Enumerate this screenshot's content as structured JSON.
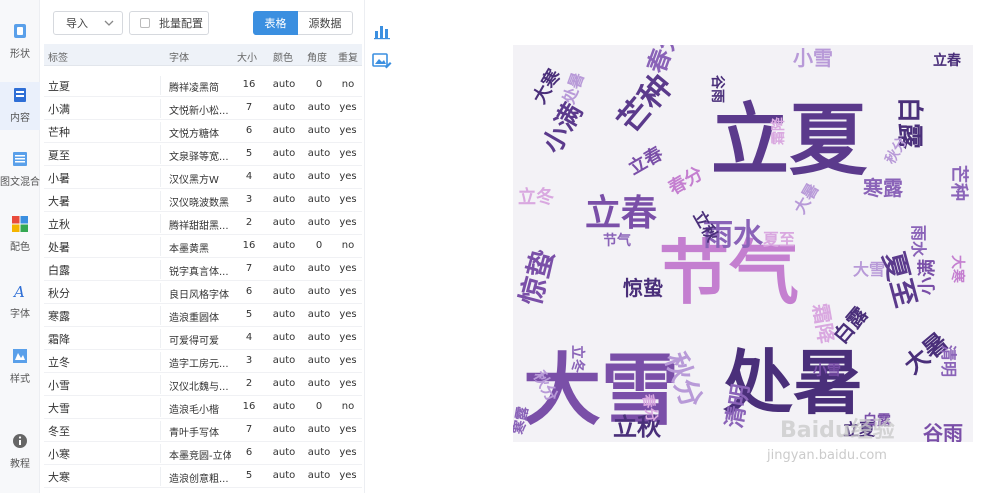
{
  "nav": [
    {
      "label": "形状",
      "icon": "shape-icon"
    },
    {
      "label": "内容",
      "icon": "content-icon"
    },
    {
      "label": "图文混合",
      "icon": "image-text-icon"
    },
    {
      "label": "配色",
      "icon": "palette-icon"
    },
    {
      "label": "字体",
      "icon": "font-icon"
    },
    {
      "label": "样式",
      "icon": "style-icon"
    },
    {
      "label": "教程",
      "icon": "info-icon"
    }
  ],
  "toolbar": {
    "import_label": "导入",
    "batch_label": "批量配置",
    "tab_table": "表格",
    "tab_source": "源数据"
  },
  "table": {
    "headers": [
      "标签",
      "字体",
      "大小",
      "颜色",
      "角度",
      "重复"
    ],
    "rows": [
      [
        "立夏",
        "腾祥凌黑简",
        "16",
        "auto",
        "0",
        "no"
      ],
      [
        "小满",
        "文悦新小松...",
        "7",
        "auto",
        "auto",
        "yes"
      ],
      [
        "芒种",
        "文悦方糖体",
        "6",
        "auto",
        "auto",
        "yes"
      ],
      [
        "夏至",
        "文泉驿等宽...",
        "5",
        "auto",
        "auto",
        "yes"
      ],
      [
        "小暑",
        "汉仪黑方W",
        "4",
        "auto",
        "auto",
        "yes"
      ],
      [
        "大暑",
        "汉仪晓波数黑",
        "3",
        "auto",
        "auto",
        "yes"
      ],
      [
        "立秋",
        "腾祥甜甜黑...",
        "2",
        "auto",
        "auto",
        "yes"
      ],
      [
        "处暑",
        "本墨黄黑",
        "16",
        "auto",
        "0",
        "no"
      ],
      [
        "白露",
        "锐字真言体...",
        "7",
        "auto",
        "auto",
        "yes"
      ],
      [
        "秋分",
        "良日风格字体",
        "6",
        "auto",
        "auto",
        "yes"
      ],
      [
        "寒露",
        "造浪重圆体",
        "5",
        "auto",
        "auto",
        "yes"
      ],
      [
        "霜降",
        "可爱得可爱",
        "4",
        "auto",
        "auto",
        "yes"
      ],
      [
        "立冬",
        "造字工房元...",
        "3",
        "auto",
        "auto",
        "yes"
      ],
      [
        "小雪",
        "汉仪北魏与...",
        "2",
        "auto",
        "auto",
        "yes"
      ],
      [
        "大雪",
        "造浪毛小楷",
        "16",
        "auto",
        "0",
        "no"
      ],
      [
        "冬至",
        "青叶手写体",
        "7",
        "auto",
        "auto",
        "yes"
      ],
      [
        "小寒",
        "本墨竞圆-立体",
        "6",
        "auto",
        "auto",
        "yes"
      ],
      [
        "大寒",
        "造浪创意粗...",
        "5",
        "auto",
        "auto",
        "yes"
      ]
    ]
  },
  "tools": [
    {
      "icon": "bar-chart-icon"
    },
    {
      "icon": "image-edit-icon"
    }
  ],
  "cloud": {
    "words": [
      "立夏",
      "节气",
      "处暑",
      "大雪",
      "立春",
      "谷雨",
      "雨水",
      "惊蛰",
      "芒种",
      "白露",
      "小满",
      "秋分",
      "春分",
      "大寒",
      "寒露",
      "夏至",
      "清明",
      "立秋",
      "大暑",
      "立冬",
      "小雪",
      "霜降"
    ],
    "colors": [
      "#5b3a8c",
      "#7a4fa8",
      "#a37bc9",
      "#c47fd0",
      "#4a2f7a",
      "#8a63b8",
      "#b89ad8",
      "#d9a8e0"
    ]
  },
  "watermark": {
    "brand": "Baidu经验",
    "url": "jingyan.baidu.com"
  }
}
